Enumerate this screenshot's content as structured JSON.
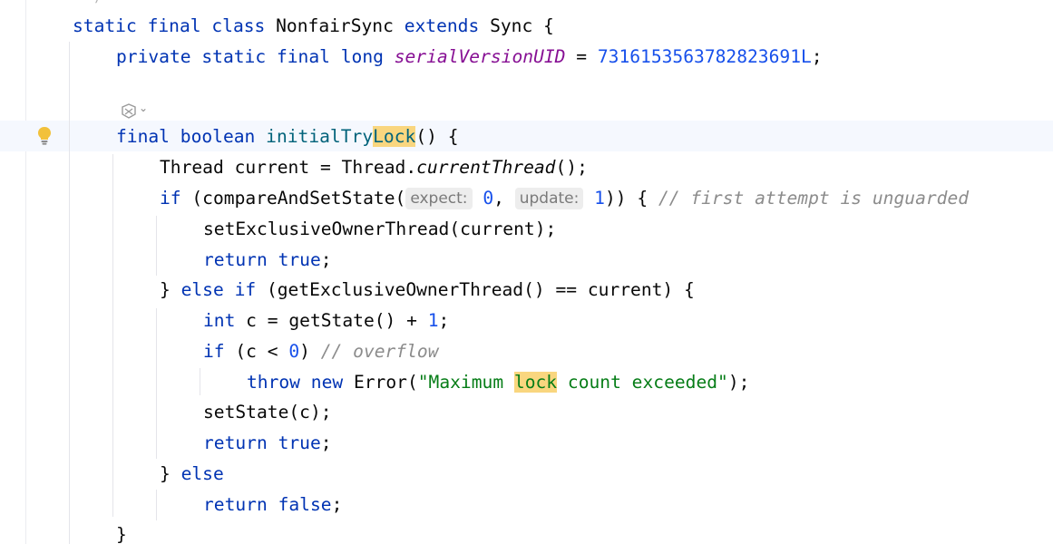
{
  "editor": {
    "top_partial": "*/",
    "lines": {
      "l1": {
        "kw1": "static final class",
        "name": " NonfairSync ",
        "kw2": "extends",
        "rest": " Sync {"
      },
      "l2": {
        "kw": "private static final long",
        "field": "serialVersionUID",
        "eq": " = ",
        "num": "7316153563782823691L",
        "semi": ";"
      },
      "l4": {
        "kw": "final boolean",
        "name_pre": "initialTry",
        "name_hl": "Lock",
        "rest": "() {"
      },
      "l5": {
        "pre": "Thread current = Thread.",
        "method": "currentThread",
        "rest": "();"
      },
      "l6": {
        "kw": "if",
        "pre": " (compareAndSetState(",
        "hint1": "expect:",
        "num1": "0",
        "comma": ", ",
        "hint2": "update:",
        "num2": "1",
        "rest": ")) { ",
        "comment": "// first attempt is unguarded"
      },
      "l7": {
        "text": "setExclusiveOwnerThread(current);"
      },
      "l8": {
        "kw": "return true",
        "semi": ";"
      },
      "l9": {
        "brace": "} ",
        "kw": "else if",
        "rest": " (getExclusiveOwnerThread() == current) {"
      },
      "l10": {
        "kw": "int",
        "pre": " c = getState() + ",
        "num": "1",
        "semi": ";"
      },
      "l11": {
        "kw": "if",
        "pre": " (c < ",
        "num": "0",
        "mid": ") ",
        "comment": "// overflow"
      },
      "l12": {
        "kw": "throw new",
        "pre": " Error(",
        "str_pre": "\"Maximum ",
        "str_hl": "lock",
        "str_post": " count exceeded\"",
        "rest": ");"
      },
      "l13": {
        "text": "setState(c);"
      },
      "l14": {
        "kw": "return true",
        "semi": ";"
      },
      "l15": {
        "brace": "} ",
        "kw": "else"
      },
      "l16": {
        "kw": "return false",
        "semi": ";"
      },
      "l17": {
        "text": "}"
      }
    }
  },
  "icons": {
    "intention": "lightbulb-icon",
    "ai_actions": "ai-assistant-icon",
    "ai_dropdown": "chevron-down-icon"
  },
  "colors": {
    "keyword": "#0033b3",
    "field": "#871094",
    "number": "#1750eb",
    "string": "#067d17",
    "comment": "#8c8c8c",
    "method_decl": "#00627a",
    "highlight": "#f9d67f",
    "caret_row": "#f5f8fe",
    "lightbulb": "#f2c13b"
  }
}
